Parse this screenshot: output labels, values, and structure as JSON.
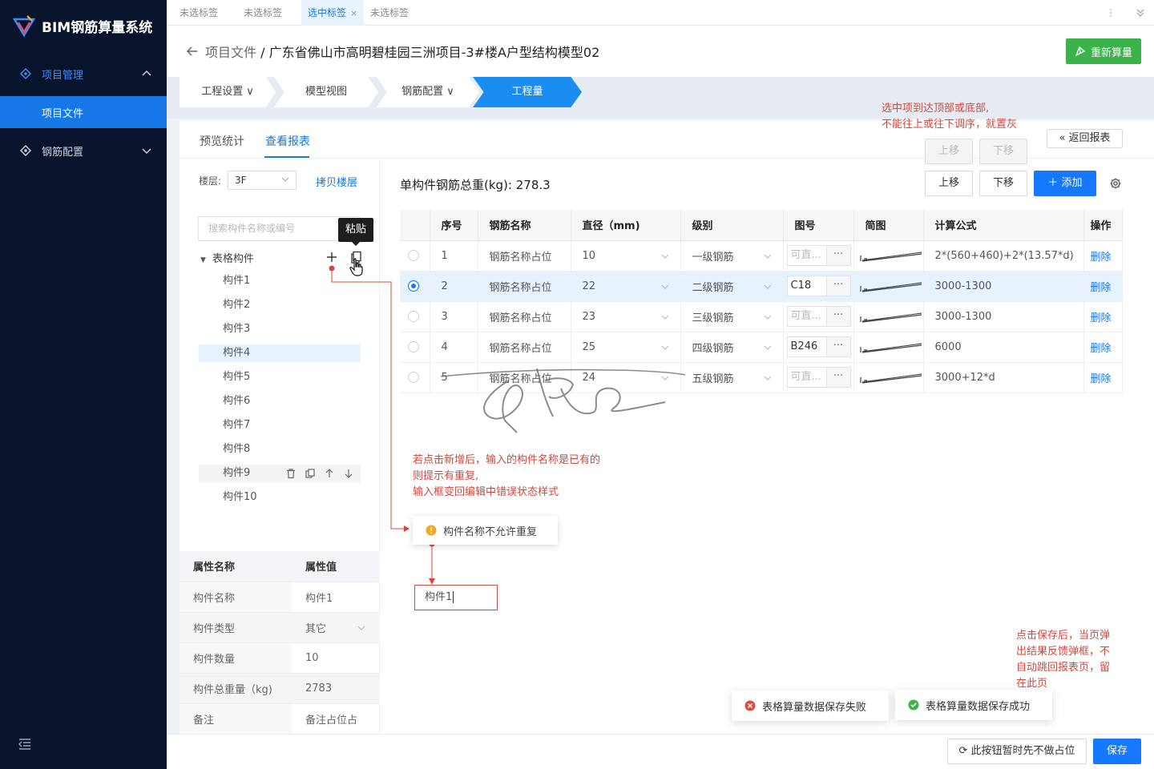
{
  "app": {
    "title": "BIM钢筋算量系统",
    "brand_color": "#1677ff",
    "success_color": "#3cb34a",
    "error_color": "#e04b41"
  },
  "sidebar": {
    "items": [
      {
        "label": "项目管理",
        "icon": "diamond-icon",
        "state": "expanded"
      },
      {
        "label": "项目文件",
        "state": "selected"
      },
      {
        "label": "钢筋配置",
        "icon": "diamond-icon",
        "state": "collapsed"
      }
    ],
    "collapse_icon": "menu-collapse-icon"
  },
  "tabs": [
    {
      "label": "未选标签"
    },
    {
      "label": "未选标签"
    },
    {
      "label": "选中标签",
      "close": "×",
      "active": true
    },
    {
      "label": "未选标签"
    }
  ],
  "header": {
    "breadcrumb_parent": "项目文件",
    "separator": "/",
    "title": "广东省佛山市高明碧桂园三洲项目-3#楼A户型结构模型02",
    "recalc_label": "重新算量"
  },
  "steps": [
    {
      "label": "工程设置 ∨"
    },
    {
      "label": "模型视图"
    },
    {
      "label": "钢筋配置 ∨"
    },
    {
      "label": "工程量",
      "active": true
    }
  ],
  "subtabs": [
    {
      "label": "预览统计"
    },
    {
      "label": "查看报表",
      "active": true
    }
  ],
  "left": {
    "floor_label": "楼层:",
    "floor_value": "3F",
    "copy_floor": "拷贝楼层",
    "search_placeholder": "搜索构件名称或编号",
    "tooltip": "粘贴",
    "tree_root": "表格构件",
    "tree_items": [
      "构件1",
      "构件2",
      "构件3",
      "构件4",
      "构件5",
      "构件6",
      "构件7",
      "构件8",
      "构件9",
      "构件10"
    ],
    "selected_item": "构件4",
    "hover_item": "构件9"
  },
  "attributes": {
    "headers": [
      "属性名称",
      "属性值"
    ],
    "rows": [
      {
        "k": "构件名称",
        "v": "构件1"
      },
      {
        "k": "构件类型",
        "v": "其它"
      },
      {
        "k": "构件数量",
        "v": "10"
      },
      {
        "k": "构件总重量（kg)",
        "v": "2783"
      },
      {
        "k": "备注",
        "v": "备注占位占"
      }
    ]
  },
  "report": {
    "total_label": "单构件钢筋总重(kg): 278.3",
    "up_label": "上移",
    "down_label": "下移",
    "add_label": "＋ 添加",
    "back_label": "返回报表",
    "columns": [
      "序号",
      "钢筋名称",
      "直径（mm)",
      "级别",
      "图号",
      "简图",
      "计算公式",
      "操作"
    ],
    "rows": [
      {
        "no": "1",
        "name": "钢筋名称占位",
        "dia": "10",
        "grade": "一级钢筋",
        "pic": "可直...",
        "pic_filled": false,
        "formula": "2*(560+460)+2*(13.57*d)",
        "op": "删除",
        "selected": false
      },
      {
        "no": "2",
        "name": "钢筋名称占位",
        "dia": "22",
        "grade": "二级钢筋",
        "pic": "C18",
        "pic_filled": true,
        "formula": "3000-1300",
        "op": "删除",
        "selected": true
      },
      {
        "no": "3",
        "name": "钢筋名称占位",
        "dia": "23",
        "grade": "三级钢筋",
        "pic": "可直...",
        "pic_filled": false,
        "formula": "3000-1300",
        "op": "删除",
        "selected": false
      },
      {
        "no": "4",
        "name": "钢筋名称占位",
        "dia": "25",
        "grade": "四级钢筋",
        "pic": "B246",
        "pic_filled": true,
        "formula": "6000",
        "op": "删除",
        "selected": false
      },
      {
        "no": "5",
        "name": "钢筋名称占位",
        "dia": "24",
        "grade": "五级钢筋",
        "pic": "可直...",
        "pic_filled": false,
        "formula": "3000+12*d",
        "op": "删除",
        "selected": false
      }
    ],
    "pic_more": "···"
  },
  "annotations": {
    "top": [
      "选中项到达顶部或底部,",
      "不能往上或往下调序，就置灰"
    ],
    "mid": [
      "若点击新增后，输入的构件名称是已有的",
      "则提示有重复,",
      "输入框变回编辑中错误状态样式"
    ],
    "bottom": [
      "点击保存后，当页弹",
      "出结果反馈弹框，不",
      "自动跳回报表页，留",
      "在此页"
    ]
  },
  "warning_text": "构件名称不允许重复",
  "name_input_value": "构件1",
  "toasts": {
    "fail": "表格算量数据保存失败",
    "success": "表格算量数据保存成功"
  },
  "footer": {
    "placeholder_btn": "此按钮暂时先不做占位",
    "save": "保存"
  }
}
